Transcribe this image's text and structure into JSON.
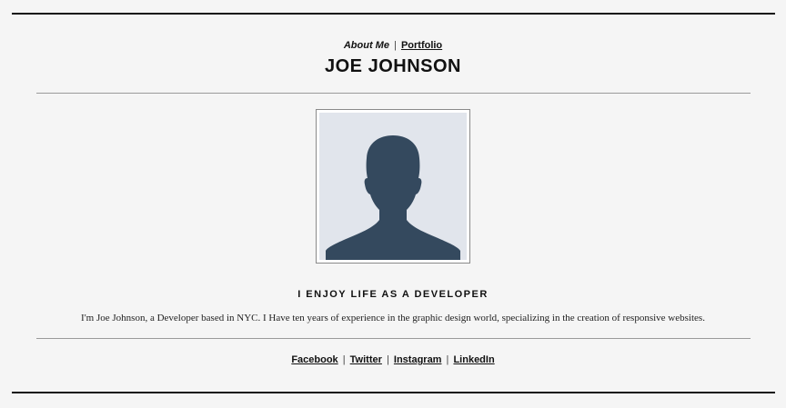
{
  "nav": {
    "current_label": "About Me",
    "separator": "|",
    "portfolio_label": "Portfolio"
  },
  "header": {
    "name": "JOE JOHNSON"
  },
  "avatar": {
    "icon": "user-silhouette-icon",
    "background_color": "#e1e5ec",
    "silhouette_color": "#34495e"
  },
  "about": {
    "tagline": "I ENJOY LIFE AS A DEVELOPER",
    "bio": "I'm Joe Johnson, a Developer based in NYC. I Have ten years of experience in the graphic design world, specializing in the creation of responsive websites."
  },
  "social": {
    "separator": "|",
    "links": [
      "Facebook",
      "Twitter",
      "Instagram",
      "LinkedIn"
    ]
  }
}
